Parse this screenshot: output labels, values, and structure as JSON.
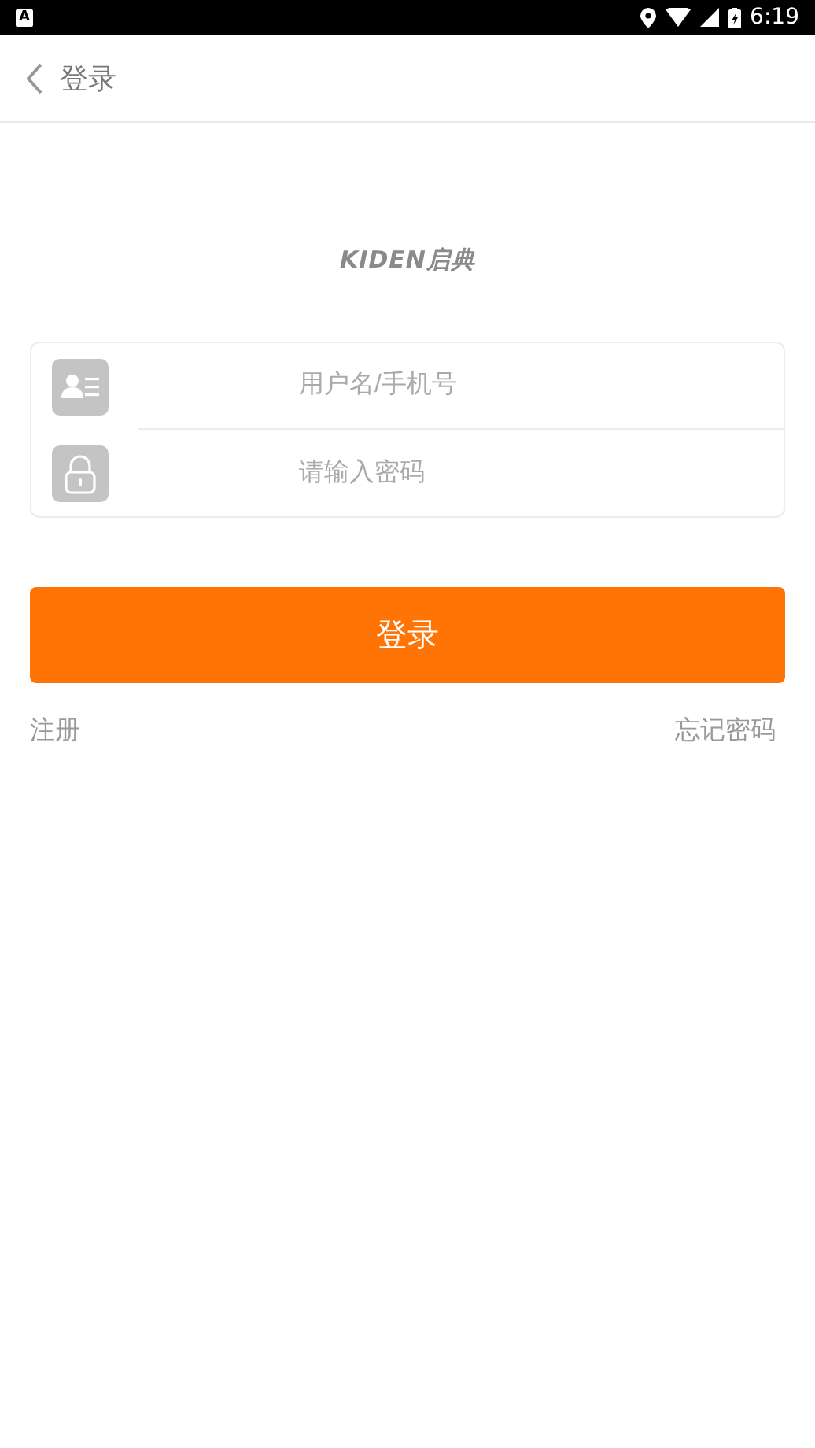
{
  "status_bar": {
    "notification": "A",
    "time": "6:19"
  },
  "header": {
    "title": "登录"
  },
  "logo": {
    "text": "KIDEN启典"
  },
  "form": {
    "fields": [
      {
        "kind": "user",
        "placeholder": "用户名/手机号"
      },
      {
        "kind": "password",
        "placeholder": "请输入密码"
      }
    ]
  },
  "login_button": "登录",
  "links": {
    "register": "注册",
    "forgot_password": "忘记密码"
  }
}
